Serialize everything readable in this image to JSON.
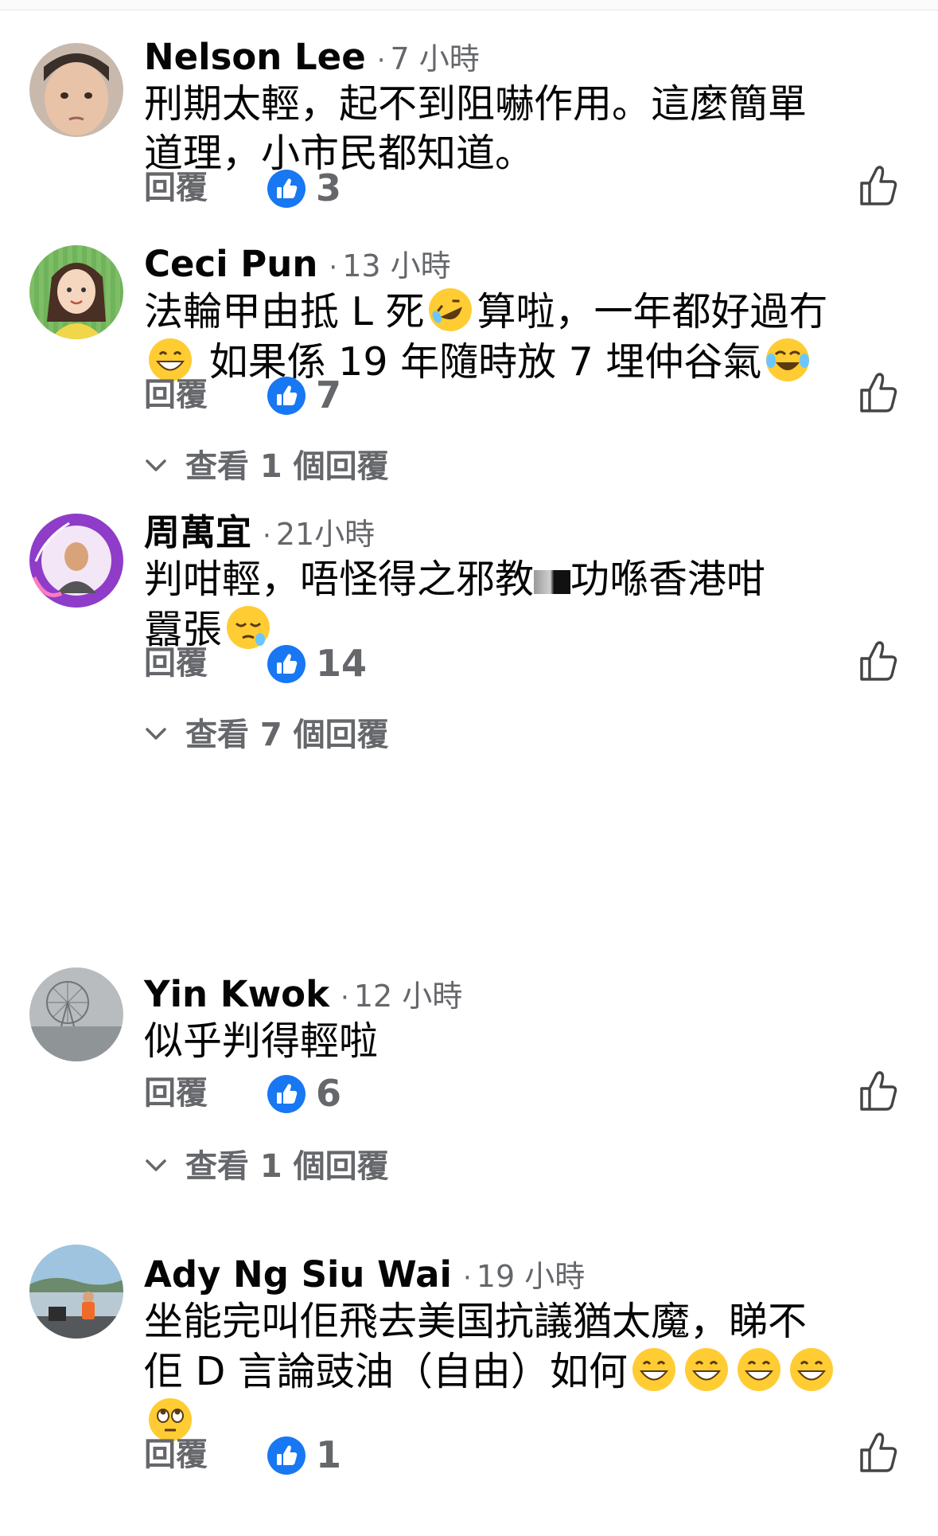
{
  "actions": {
    "reply_label": "回覆"
  },
  "comments": [
    {
      "name": "Nelson Lee",
      "time": "7 小時",
      "lines": [
        "刑期太輕，起不到阻嚇作用。這麼簡單",
        "道理，小市民都知道。"
      ],
      "likes": "3"
    },
    {
      "name": "Ceci Pun",
      "time": "13 小時",
      "line1_a": "法輪甲由抵 L 死",
      "line1_b": "算啦，一年都好過冇",
      "line2": "如果係 19 年隨時放 7 埋仲谷氣",
      "likes": "7",
      "view_replies": "查看 1 個回覆"
    },
    {
      "name": "周萬宜",
      "time": "21小時",
      "line1_a": "判咁輕，唔怪得之邪教",
      "line1_b": "功喺香港咁",
      "line2": "囂張",
      "likes": "14",
      "view_replies": "查看 7 個回覆"
    },
    {
      "name": "Yin Kwok",
      "time": "12 小時",
      "line1": "似乎判得輕啦",
      "likes": "6",
      "view_replies": "查看 1 個回覆"
    },
    {
      "name": "Ady Ng Siu Wai",
      "time": "19 小時",
      "line1": "坐能完叫佢飛去美国抗議猶太魔，睇不",
      "line2": "佢 D 言論豉油（自由）如何",
      "likes": "1"
    }
  ],
  "colors": {
    "like_blue": "#1877f2",
    "secondary_text": "#65676b"
  }
}
